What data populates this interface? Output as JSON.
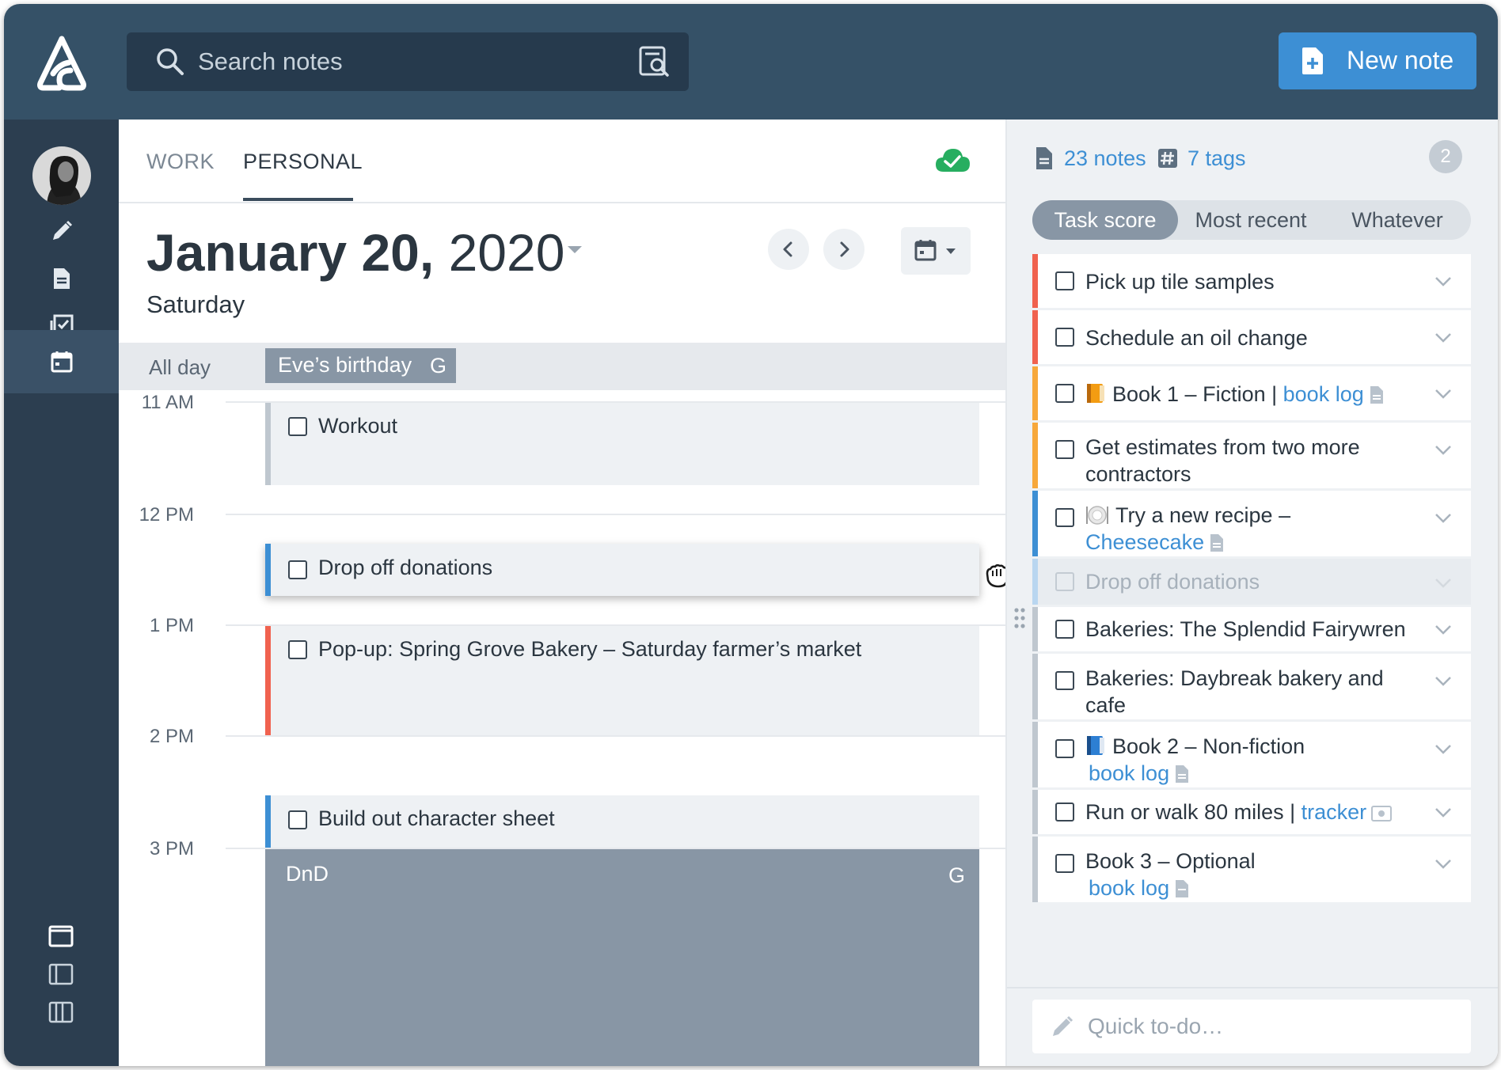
{
  "header": {
    "search_placeholder": "Search notes",
    "new_note_label": "New note"
  },
  "tabs": [
    {
      "label": "WORK"
    },
    {
      "label": "PERSONAL",
      "active": true
    }
  ],
  "date": {
    "month_day": "January 20,",
    "year": "2020",
    "weekday": "Saturday"
  },
  "allday": {
    "label": "All day",
    "events": [
      {
        "title": "Eve’s birthday",
        "source": "G"
      }
    ]
  },
  "hours": [
    "11 AM",
    "12 PM",
    "1 PM",
    "2 PM",
    "3 PM"
  ],
  "events": [
    {
      "title": "Workout",
      "color": "#bfc7cf"
    },
    {
      "title": "Drop off donations",
      "color": "#3d8fd4"
    },
    {
      "title": "Pop-up: Spring Grove Bakery – Saturday farmer’s market",
      "color": "#f0624f"
    },
    {
      "title": "Build out character sheet",
      "color": "#3d8fd4"
    },
    {
      "title": "DnD",
      "source": "G"
    }
  ],
  "stats": {
    "notes": "23 notes",
    "tags": "7 tags",
    "badge": "2"
  },
  "sort": [
    "Task score",
    "Most recent",
    "Whatever"
  ],
  "tasks": [
    {
      "text": "Pick up tile samples",
      "color": "#f0624f"
    },
    {
      "text": "Schedule an oil change",
      "color": "#f0624f"
    },
    {
      "text": "Book 1 – Fiction |",
      "link": "book log",
      "color": "#f7a83b"
    },
    {
      "text": "Get estimates from two more contractors",
      "color": "#f7a83b"
    },
    {
      "text": "Try a new recipe –",
      "link": "Cheesecake",
      "color": "#3d8fd4"
    },
    {
      "text": "Drop off donations",
      "color": "#b9d6f0"
    },
    {
      "text": "Bakeries: The Splendid Fairywren",
      "color": "#bfc7cf"
    },
    {
      "text": "Bakeries: Daybreak bakery and cafe",
      "color": "#bfc7cf"
    },
    {
      "text": "Book 2 – Non-fiction",
      "link": "book log",
      "color": "#bfc7cf"
    },
    {
      "text": "Run or walk 80 miles |",
      "link": "tracker",
      "color": "#bfc7cf"
    },
    {
      "text": "Book 3 – Optional",
      "link": "book log",
      "color": "#bfc7cf"
    }
  ],
  "quick_todo_placeholder": "Quick to-do…",
  "colors": {
    "topbar": "#355167",
    "rail": "#2c3e50",
    "accent": "#3d8fd4",
    "red": "#f0624f",
    "orange": "#f7a83b",
    "gray_event": "#8896a5"
  }
}
